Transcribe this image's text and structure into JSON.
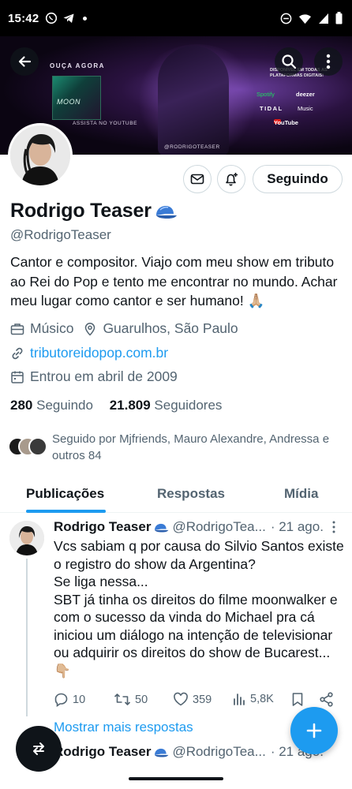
{
  "status": {
    "time": "15:42",
    "icons": [
      "whatsapp-icon",
      "telegram-icon",
      "dnd-icon",
      "wifi-icon",
      "signal-icon",
      "battery-icon"
    ]
  },
  "banner": {
    "ouca": "OUÇA AGORA",
    "album": "MOON",
    "youtube_note": "ASSISTA NO YOUTUBE",
    "insta": "@RODRIGOTEASER",
    "disponivel": "DISPONÍVEL EM TODAS AS PLATAFORMAS DIGITAIS!",
    "platforms": [
      "Spotify",
      "deezer",
      "TIDAL",
      "Music",
      "YouTube"
    ]
  },
  "profile": {
    "name": "Rodrigo Teaser",
    "handle": "@RodrigoTeaser",
    "follow_label": "Seguindo",
    "bio": "Cantor e compositor. Viajo com meu show em tributo ao Rei do Pop e tento me encontrar no mundo. Achar meu lugar como cantor e ser humano! 🙏🏼",
    "occupation": "Músico",
    "location": "Guarulhos, São Paulo",
    "website": "tributoreidopop.com.br",
    "joined": "Entrou em abril de 2009",
    "following_count": "280",
    "following_label": "Seguindo",
    "followers_count": "21.809",
    "followers_label": "Seguidores",
    "followed_by": "Seguido por Mjfriends, Mauro Alexandre, Andressa e outros 84"
  },
  "tabs": [
    "Publicações",
    "Respostas",
    "Mídia"
  ],
  "tweet": {
    "name": "Rodrigo Teaser",
    "handle": "@RodrigoTea...",
    "date": "· 21 ago.",
    "text": "Vcs sabiam q por causa do Silvio Santos existe o registro do show da Argentina?\nSe liga nessa...\nSBT já tinha os direitos do filme moonwalker e com o sucesso da vinda do Michael pra cá iniciou um diálogo na intenção de televisionar ou adquirir os direitos do show de Bucarest...\n👇🏼",
    "replies": "10",
    "retweets": "50",
    "likes": "359",
    "views": "5,8K"
  },
  "show_more": "Mostrar mais respostas",
  "tweet2": {
    "name": "Rodrigo Teaser",
    "handle": "@RodrigoTea...",
    "date": "· 21 ago."
  },
  "colors": {
    "accent": "#1d9bf0",
    "text": "#0f1419",
    "muted": "#536471"
  }
}
